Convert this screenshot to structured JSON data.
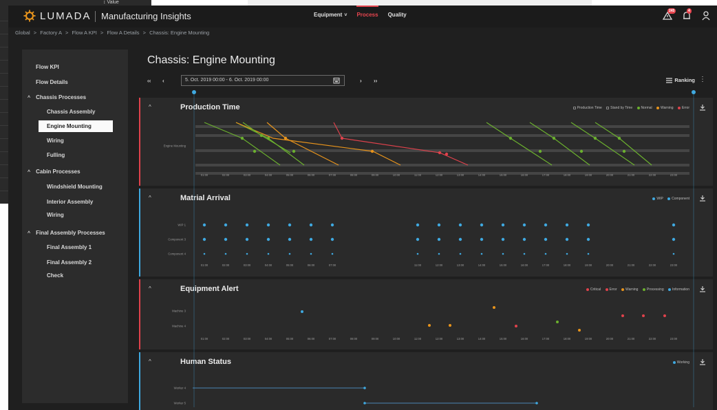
{
  "ghost": {
    "top_label": "↕ Value"
  },
  "app": {
    "logo_text": "LUMADA",
    "title": "Manufacturing Insights"
  },
  "nav": {
    "items": [
      {
        "label": "Equipment",
        "caret": "˅"
      },
      {
        "label": "Process"
      },
      {
        "label": "Quality"
      }
    ]
  },
  "alerts": {
    "alarm_badge": "245",
    "bell_badge": "4"
  },
  "breadcrumb": [
    "Global",
    ">",
    "Factory A",
    ">",
    "Flow A KPI",
    ">",
    "Flow A Details",
    ">",
    "Chassis: Engine Mounting"
  ],
  "sidebar": {
    "items": [
      {
        "label": "Flow KPI"
      },
      {
        "label": "Flow Details"
      },
      {
        "label": "Chassis Processes",
        "caret": "^"
      },
      {
        "label": "Chassis Assembly"
      },
      {
        "label": "Engine Mounting"
      },
      {
        "label": "Wiring"
      },
      {
        "label": "Fulling"
      },
      {
        "label": "Cabin Processes",
        "caret": "^"
      },
      {
        "label": "Windshield Mounting"
      },
      {
        "label": "Interior Assembly"
      },
      {
        "label": "Wiring"
      },
      {
        "label": "Final Assembly Processes",
        "caret": "^"
      },
      {
        "label": "Final Assembly 1"
      },
      {
        "label": "Final Assembly 2"
      },
      {
        "label": "Check"
      }
    ]
  },
  "page": {
    "title": "Chassis: Engine Mounting",
    "first": "‹‹",
    "prev": "‹",
    "next": "›",
    "last": "››",
    "date_range": "5. Oct. 2019 00:00 - 6. Oct. 2019 00:00",
    "ranking": "Ranking",
    "more": "⋮"
  },
  "colors": {
    "green": "#6bb02e",
    "orange": "#e8941c",
    "red": "#e0424c",
    "blue": "#3fa9e0",
    "grey": "#8a8a8a"
  },
  "time_labels": [
    "01:00",
    "02:00",
    "03:00",
    "04:00",
    "05:00",
    "06:00",
    "07:00",
    "08:00",
    "09:00",
    "10:00",
    "11:00",
    "12:00",
    "13:00",
    "14:00",
    "15:00",
    "16:00",
    "17:00",
    "18:00",
    "19:00",
    "20:00",
    "21:00",
    "22:00",
    "23:00"
  ],
  "panels": {
    "production": {
      "title": "Production Time",
      "legend": {
        "production_time": "Production Time",
        "stand_by": "Stand by Time",
        "normal": "Normal",
        "warning": "Warning",
        "error": "Error"
      },
      "row_label": "Engine Mounting"
    },
    "material": {
      "title": "Matrial Arrival",
      "legend": {
        "wip": "WIP",
        "component": "Component"
      },
      "rows": [
        "WIP 1",
        "Component 3",
        "Component 4"
      ]
    },
    "equipment": {
      "title": "Equipment Alert",
      "legend": {
        "critical": "Critical",
        "error": "Error",
        "warning": "Warning",
        "processing": "Processing",
        "information": "Information"
      },
      "rows": [
        "Machine 3",
        "Machine 4"
      ]
    },
    "human": {
      "title": "Human Status",
      "legend": {
        "working": "Working"
      },
      "rows": [
        "Worker 4",
        "Worker 5"
      ]
    }
  }
}
